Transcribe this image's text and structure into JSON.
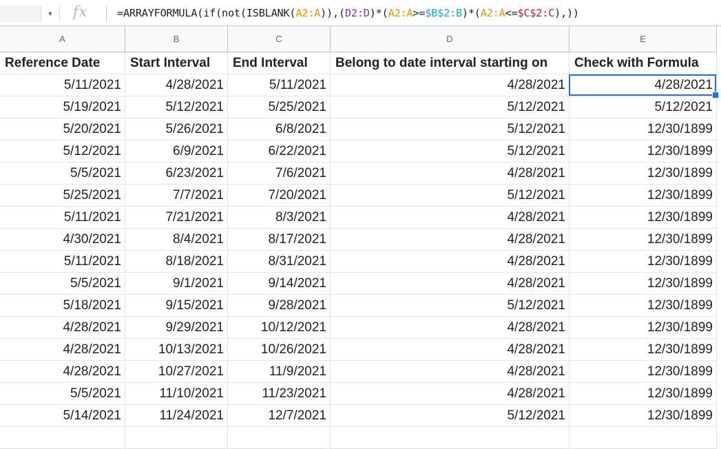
{
  "formula_bar": {
    "fx_label": "fx",
    "dropdown_icon": "chevron-down-icon",
    "tokens": [
      {
        "t": "=ARRAYFORMULA(if(not(ISBLANK(",
        "c": ""
      },
      {
        "t": "A2:A",
        "c": "a"
      },
      {
        "t": ")),(",
        "c": ""
      },
      {
        "t": "D2:D",
        "c": "d"
      },
      {
        "t": ")*(",
        "c": ""
      },
      {
        "t": "A2:A",
        "c": "a"
      },
      {
        "t": ">=",
        "c": ""
      },
      {
        "t": "$B$2:B",
        "c": "b"
      },
      {
        "t": ")*(",
        "c": ""
      },
      {
        "t": "A2:A",
        "c": "a"
      },
      {
        "t": "<=",
        "c": ""
      },
      {
        "t": "$C$2:C",
        "c": "c"
      },
      {
        "t": "),))",
        "c": ""
      }
    ]
  },
  "colors": {
    "range_a": "#f09300",
    "range_d": "#7e3794",
    "range_b": "#11a9cc",
    "range_c": "#a61d4c",
    "selection": "#1a73e8"
  },
  "columns": [
    "A",
    "B",
    "C",
    "D",
    "E"
  ],
  "headers": [
    "Reference Date",
    "Start Interval",
    "End Interval",
    "Belong to date interval starting on",
    "Check with Formula"
  ],
  "rows": [
    [
      "5/11/2021",
      "4/28/2021",
      "5/11/2021",
      "4/28/2021",
      "4/28/2021"
    ],
    [
      "5/19/2021",
      "5/12/2021",
      "5/25/2021",
      "5/12/2021",
      "5/12/2021"
    ],
    [
      "5/20/2021",
      "5/26/2021",
      "6/8/2021",
      "5/12/2021",
      "12/30/1899"
    ],
    [
      "5/12/2021",
      "6/9/2021",
      "6/22/2021",
      "5/12/2021",
      "12/30/1899"
    ],
    [
      "5/5/2021",
      "6/23/2021",
      "7/6/2021",
      "4/28/2021",
      "12/30/1899"
    ],
    [
      "5/25/2021",
      "7/7/2021",
      "7/20/2021",
      "5/12/2021",
      "12/30/1899"
    ],
    [
      "5/11/2021",
      "7/21/2021",
      "8/3/2021",
      "4/28/2021",
      "12/30/1899"
    ],
    [
      "4/30/2021",
      "8/4/2021",
      "8/17/2021",
      "4/28/2021",
      "12/30/1899"
    ],
    [
      "5/11/2021",
      "8/18/2021",
      "8/31/2021",
      "4/28/2021",
      "12/30/1899"
    ],
    [
      "5/5/2021",
      "9/1/2021",
      "9/14/2021",
      "4/28/2021",
      "12/30/1899"
    ],
    [
      "5/18/2021",
      "9/15/2021",
      "9/28/2021",
      "5/12/2021",
      "12/30/1899"
    ],
    [
      "4/28/2021",
      "9/29/2021",
      "10/12/2021",
      "4/28/2021",
      "12/30/1899"
    ],
    [
      "4/28/2021",
      "10/13/2021",
      "10/26/2021",
      "4/28/2021",
      "12/30/1899"
    ],
    [
      "4/28/2021",
      "10/27/2021",
      "11/9/2021",
      "4/28/2021",
      "12/30/1899"
    ],
    [
      "5/5/2021",
      "11/10/2021",
      "11/23/2021",
      "4/28/2021",
      "12/30/1899"
    ],
    [
      "5/14/2021",
      "11/24/2021",
      "12/7/2021",
      "5/12/2021",
      "12/30/1899"
    ]
  ]
}
